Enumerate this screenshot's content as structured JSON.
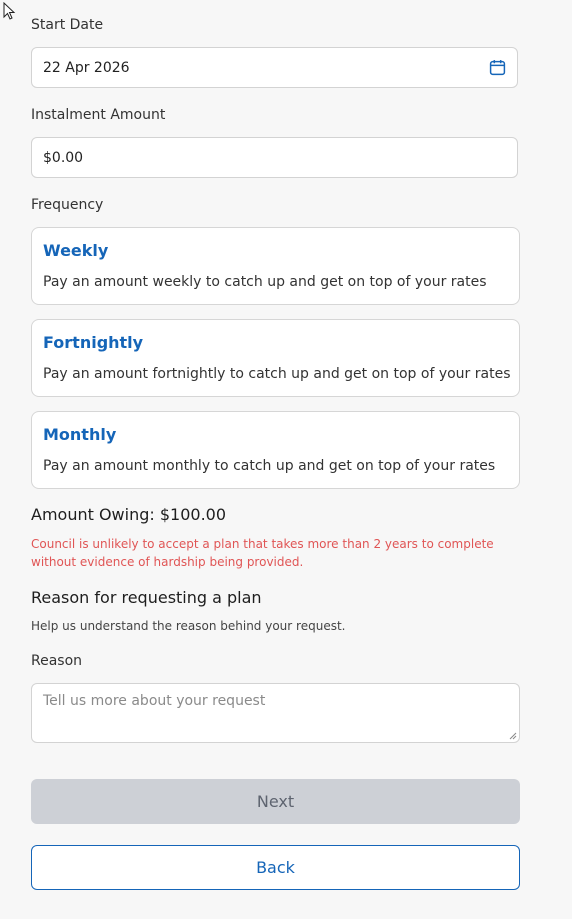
{
  "start_date": {
    "label": "Start Date",
    "value": "22 Apr 2026",
    "icon": "calendar-icon"
  },
  "instalment": {
    "label": "Instalment Amount",
    "value": "$0.00"
  },
  "frequency": {
    "label": "Frequency",
    "options": [
      {
        "title": "Weekly",
        "description": "Pay an amount weekly to catch up and get on top of your rates"
      },
      {
        "title": "Fortnightly",
        "description": "Pay an amount fortnightly to catch up and get on top of your rates"
      },
      {
        "title": "Monthly",
        "description": "Pay an amount monthly to catch up and get on top of your rates"
      }
    ]
  },
  "amount_owing": "Amount Owing: $100.00",
  "warning": "Council is unlikely to accept a plan that takes more than 2 years to complete without evidence of hardship being provided.",
  "reason_section": {
    "title": "Reason for requesting a plan",
    "helper": "Help us understand the reason behind your request.",
    "label": "Reason",
    "placeholder": "Tell us more about your request"
  },
  "buttons": {
    "next": "Next",
    "back": "Back"
  },
  "colors": {
    "accent": "#1565b8",
    "warning": "#e05555",
    "disabled_button": "#cdd0d6"
  }
}
